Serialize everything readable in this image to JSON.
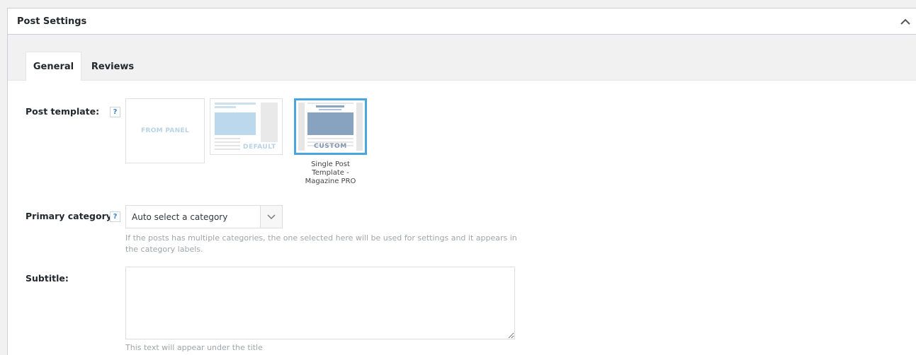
{
  "metabox": {
    "title": "Post Settings",
    "toggle_icon": "chevron-up-icon"
  },
  "tabs": [
    {
      "label": "General",
      "active": true
    },
    {
      "label": "Reviews",
      "active": false
    }
  ],
  "fields": {
    "post_template": {
      "label": "Post template:",
      "help": "?",
      "options": [
        {
          "label": "FROM PANEL"
        },
        {
          "label": "DEFAULT"
        },
        {
          "label": "CUSTOM",
          "selected": true,
          "caption": "Single Post Template - Magazine PRO"
        }
      ]
    },
    "primary_category": {
      "label": "Primary category:",
      "help": "?",
      "selected": "Auto select a category",
      "description": "If the posts has multiple categories, the one selected here will be used for settings and it appears in the category labels."
    },
    "subtitle": {
      "label": "Subtitle:",
      "value": "",
      "description": "This text will appear under the title"
    }
  },
  "colors": {
    "accent": "#4ba5de",
    "help": "#3a82c4"
  }
}
